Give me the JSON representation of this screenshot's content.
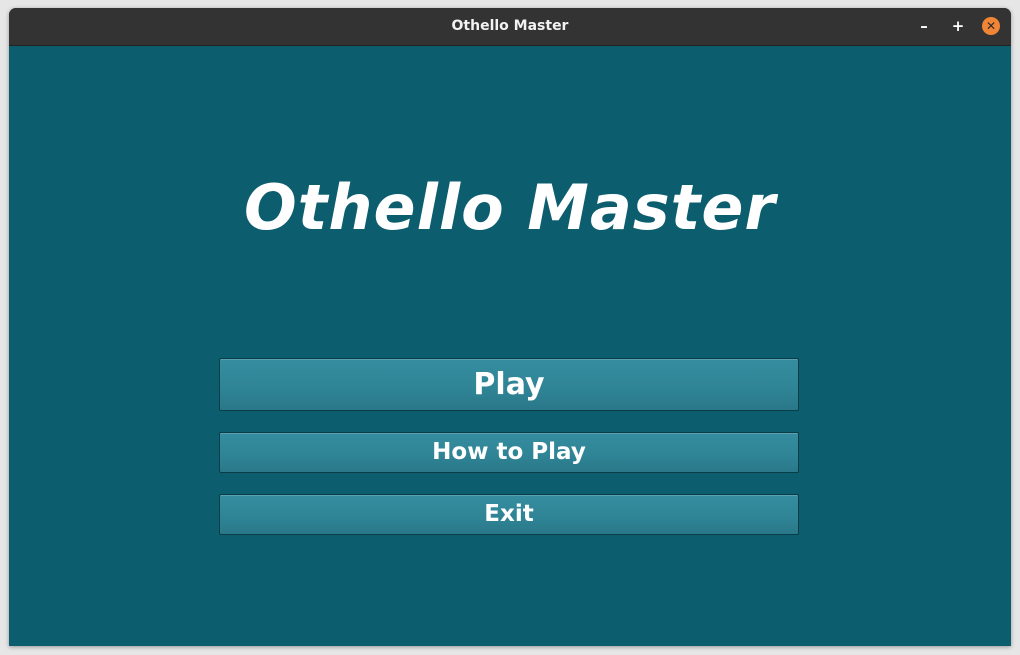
{
  "window": {
    "title": "Othello Master",
    "minimize_label": "–",
    "maximize_label": "+",
    "close_label": "✕"
  },
  "menu": {
    "game_title": "Othello Master",
    "play_label": "Play",
    "how_to_play_label": "How to Play",
    "exit_label": "Exit"
  },
  "colors": {
    "background": "#0c5e6e",
    "button": "#2f8596",
    "titlebar": "#333333",
    "close_button": "#f08437"
  }
}
